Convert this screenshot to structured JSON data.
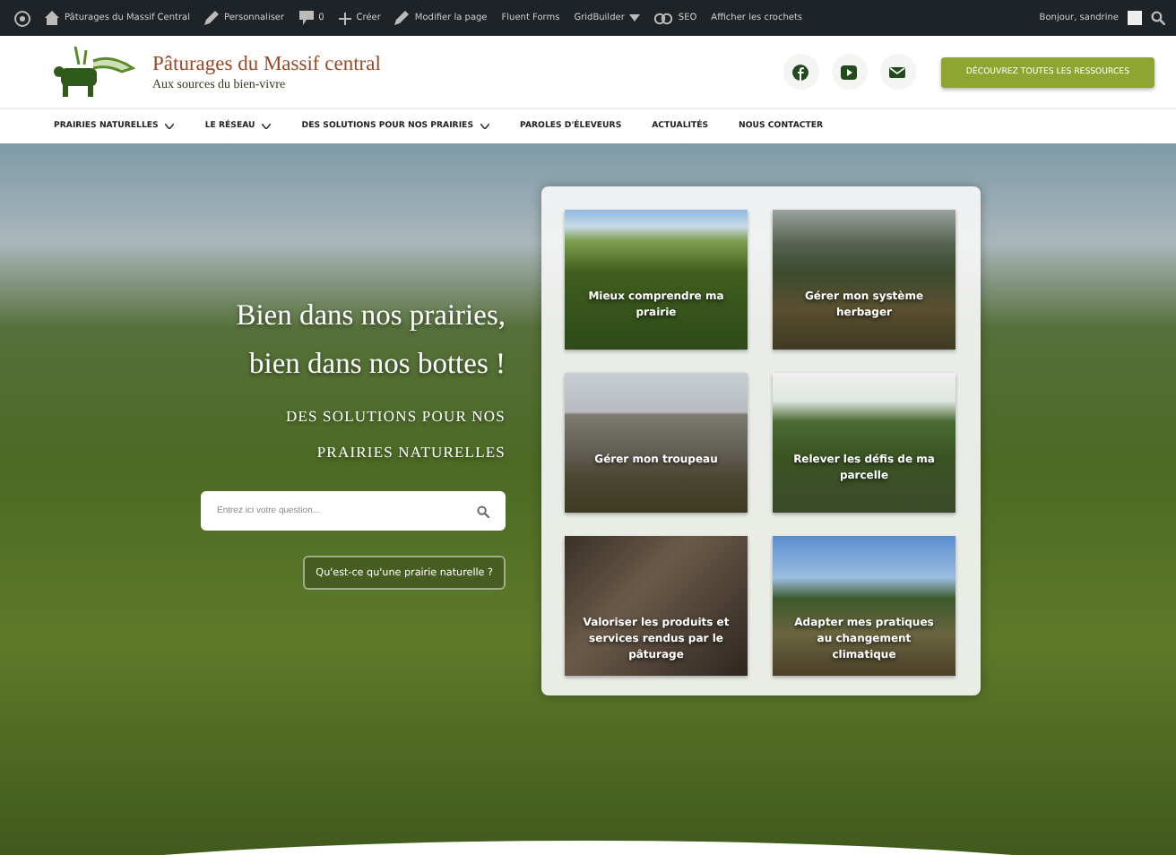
{
  "admin_bar": {
    "items": [
      {
        "kind": "logo"
      },
      {
        "kind": "house",
        "label": "Pâturages du Massif Central"
      },
      {
        "kind": "pencil",
        "label": "Personnaliser"
      },
      {
        "kind": "comment",
        "label": "0"
      },
      {
        "kind": "plus",
        "label": "Créer"
      },
      {
        "kind": "pencil",
        "label": "Modifier la page"
      },
      {
        "kind": "text",
        "label": "Fluent Forms"
      },
      {
        "kind": "caret",
        "label": "GridBuilder"
      },
      {
        "kind": "seo",
        "label": "SEO"
      },
      {
        "kind": "text",
        "label": "Afficher les crochets"
      }
    ],
    "greeting": "Bonjour, sandrine"
  },
  "header": {
    "site_title": "Pâturages du Massif central",
    "tagline": "Aux sources du bien-vivre",
    "social": [
      {
        "kind": "f"
      },
      {
        "kind": "play"
      },
      {
        "kind": "mail"
      }
    ],
    "cta": "DÉCOUVREZ TOUTES LES RESSOURCES"
  },
  "nav": [
    {
      "label": "PRAIRIES NATURELLES",
      "dropdown": true
    },
    {
      "label": "LE RÉSEAU",
      "dropdown": true
    },
    {
      "label": "DES SOLUTIONS POUR NOS PRAIRIES",
      "dropdown": true
    },
    {
      "label": "PAROLES D'ÉLEVEURS",
      "dropdown": false
    },
    {
      "label": "ACTUALITÉS",
      "dropdown": false
    },
    {
      "label": "NOUS CONTACTER",
      "dropdown": false
    }
  ],
  "hero": {
    "headline": "Bien dans nos prairies, bien dans nos bottes !",
    "subtitle": "DES SOLUTIONS POUR NOS PRAIRIES NATURELLES",
    "search": {
      "placeholder": "Entrez ici votre question..."
    },
    "link": "Qu'est-ce qu'une prairie naturelle ?",
    "cards": [
      {
        "title": "Mieux comprendre ma prairie",
        "kind": "meadow"
      },
      {
        "title": "Gérer mon système herbager",
        "kind": "hay"
      },
      {
        "title": "Gérer mon troupeau",
        "kind": "herd"
      },
      {
        "title": "Relever les défis de ma parcelle",
        "kind": "plot"
      },
      {
        "title": "Valoriser les produits et services rendus par le pâturage",
        "kind": "cheese"
      },
      {
        "title": "Adapter mes pratiques au changement climatique",
        "kind": "landscape"
      }
    ]
  }
}
